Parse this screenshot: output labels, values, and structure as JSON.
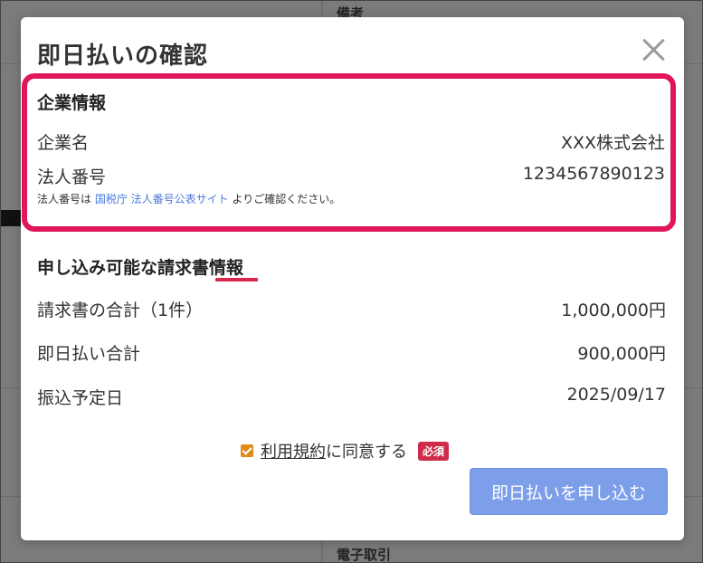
{
  "background": {
    "top_label": "備考",
    "bottom_label": "電子取引"
  },
  "modal": {
    "title": "即日払いの確認",
    "close_icon": "close-icon",
    "company_section": {
      "heading": "企業情報",
      "company_name_label": "企業名",
      "company_name_value": "XXX株式会社",
      "corp_number_label": "法人番号",
      "corp_number_value": "1234567890123",
      "note_prefix": "法人番号は",
      "note_link": "国税庁 法人番号公表サイト",
      "note_suffix": "よりご確認ください。"
    },
    "invoice_section": {
      "heading": "申し込み可能な請求書情報",
      "rows": [
        {
          "label": "請求書の合計（1件）",
          "value": "1,000,000円"
        },
        {
          "label": "即日払い合計",
          "value": "900,000円"
        },
        {
          "label": "振込予定日",
          "value": "2025/09/17"
        }
      ]
    },
    "terms": {
      "checked": true,
      "link_text": "利用規約",
      "suffix": "に同意する",
      "required_badge": "必須"
    },
    "submit_label": "即日払いを申し込む"
  },
  "colors": {
    "highlight_border": "#e0165b",
    "accent_underline": "#d4284f",
    "submit_button": "#7d9ee8",
    "link": "#4a7bd9",
    "checkbox": "#e08a1c",
    "required_badge": "#cf2b4a"
  }
}
